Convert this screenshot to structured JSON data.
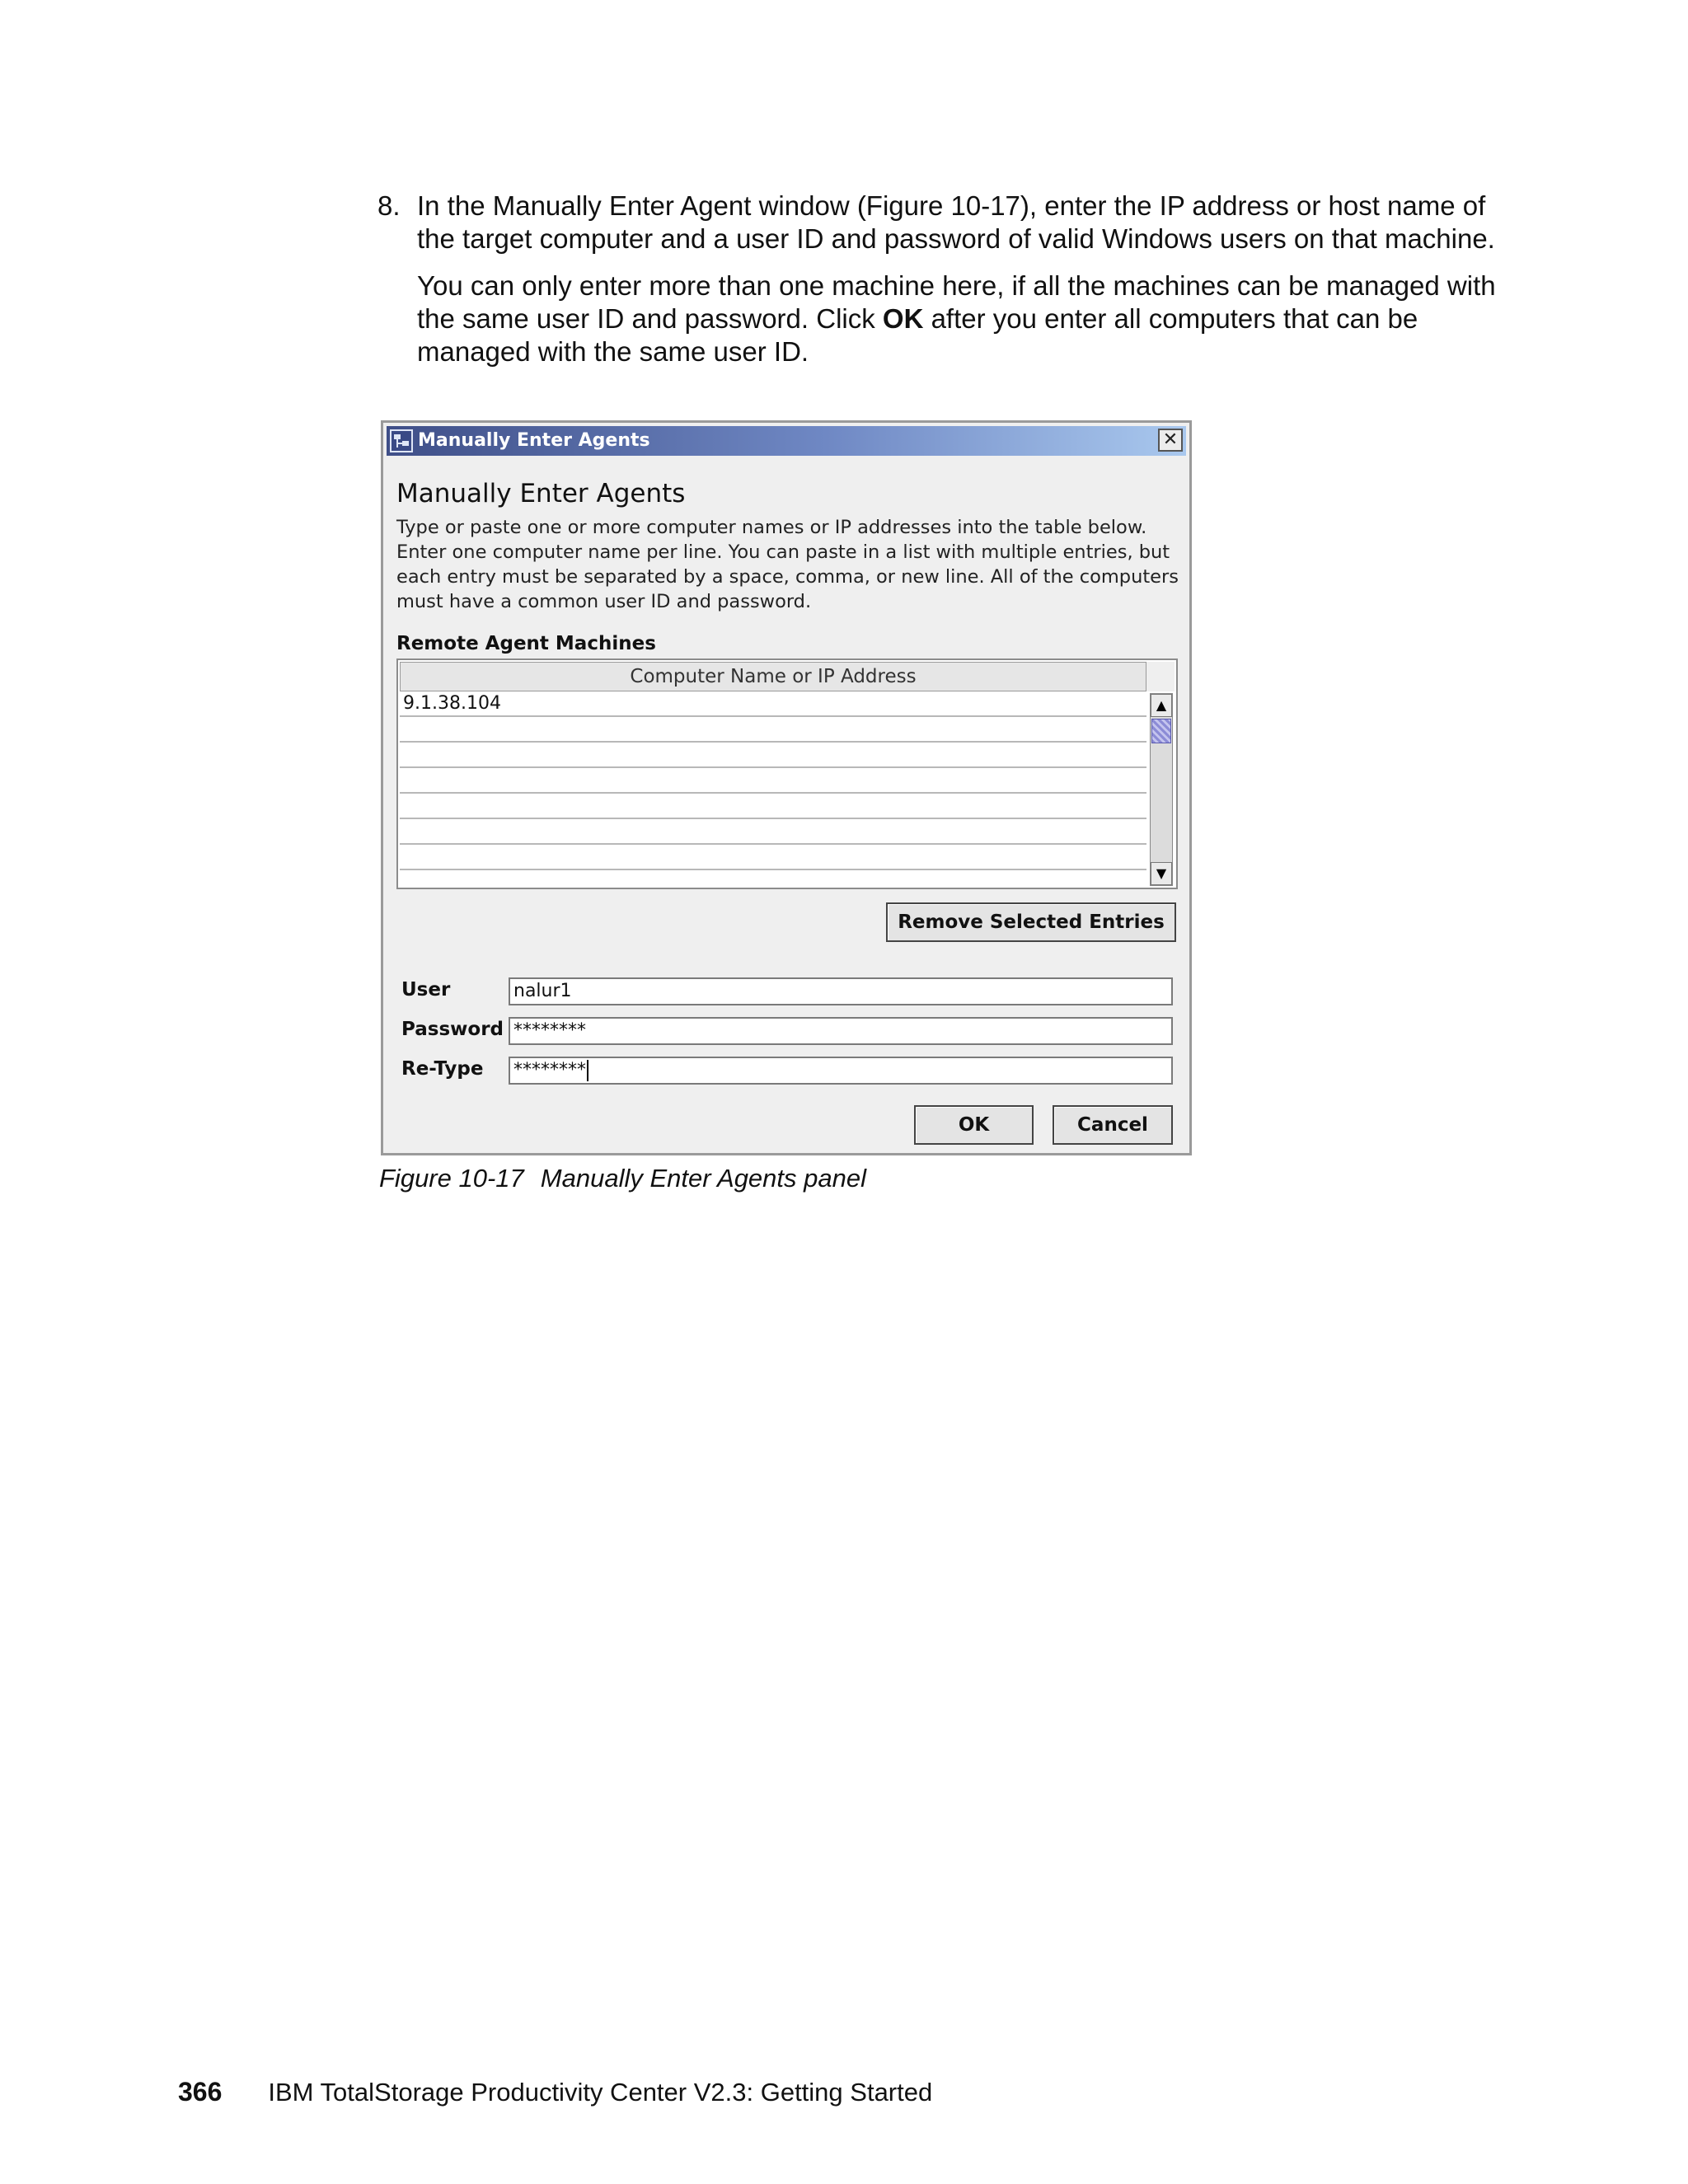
{
  "step": {
    "number": "8.",
    "paragraph1": "In the Manually Enter Agent window (Figure 10-17), enter the IP address or host name of the target computer and a user ID and password of valid Windows users on that machine.",
    "paragraph2_before": "You can only enter more than one machine here, if all the machines can be managed with the same user ID and password. Click ",
    "paragraph2_bold": "OK",
    "paragraph2_after": " after you enter all computers that can be managed with the same user ID."
  },
  "dialog": {
    "window_title": "Manually Enter Agents",
    "close_glyph": "✕",
    "heading": "Manually Enter Agents",
    "description": "Type or paste one or more computer names or IP addresses into the table below. Enter one computer name per line. You can paste in a list with multiple entries, but each entry must be separated by a space, comma, or new line. All of the computers must have a common user ID and password.",
    "section_label": "Remote Agent Machines",
    "table": {
      "column_header": "Computer Name or IP Address",
      "rows": [
        "9.1.38.104",
        "",
        "",
        "",
        "",
        "",
        ""
      ]
    },
    "remove_button": "Remove Selected Entries",
    "user_label": "User",
    "user_value": "nalur1",
    "password_label": "Password",
    "password_value": "********",
    "retype_label": "Re-Type",
    "retype_value": "********",
    "ok_button": "OK",
    "cancel_button": "Cancel"
  },
  "caption": {
    "figure_id": "Figure 10-17",
    "text": "Manually Enter Agents panel"
  },
  "footer": {
    "page_number": "366",
    "book_title": "IBM TotalStorage Productivity Center V2.3: Getting Started"
  }
}
